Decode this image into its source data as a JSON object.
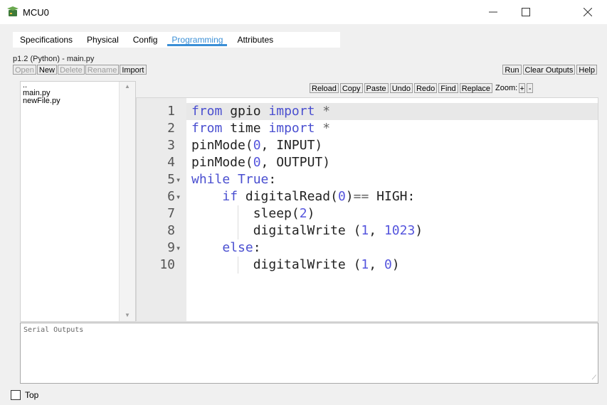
{
  "window": {
    "title": "MCU0",
    "icon": "mcu-device-icon",
    "controls": {
      "minimize": "—",
      "maximize": "☐",
      "close": "✕"
    }
  },
  "tabs": [
    {
      "label": "Specifications",
      "active": false
    },
    {
      "label": "Physical",
      "active": false
    },
    {
      "label": "Config",
      "active": false
    },
    {
      "label": "Programming",
      "active": true
    },
    {
      "label": "Attributes",
      "active": false
    }
  ],
  "project": {
    "label": "p1.2 (Python) - main.py"
  },
  "file_buttons": {
    "open": "Open",
    "new": "New",
    "delete": "Delete",
    "rename": "Rename",
    "import": "Import"
  },
  "run_buttons": {
    "run": "Run",
    "clear": "Clear Outputs",
    "help": "Help"
  },
  "files": [
    "..",
    "main.py",
    "newFile.py"
  ],
  "editor_toolbar": {
    "reload": "Reload",
    "copy": "Copy",
    "paste": "Paste",
    "undo": "Undo",
    "redo": "Redo",
    "find": "Find",
    "replace": "Replace",
    "zoom_label": "Zoom:",
    "zoom_in": "+",
    "zoom_out": "-"
  },
  "code_lines": [
    {
      "n": "1",
      "fold": "",
      "text": "from gpio import *"
    },
    {
      "n": "2",
      "fold": "",
      "text": "from time import *"
    },
    {
      "n": "3",
      "fold": "",
      "text": "pinMode(0, INPUT)"
    },
    {
      "n": "4",
      "fold": "",
      "text": "pinMode(0, OUTPUT)"
    },
    {
      "n": "5",
      "fold": "▾",
      "text": "while True:"
    },
    {
      "n": "6",
      "fold": "▾",
      "text": "    if digitalRead(0)== HIGH:"
    },
    {
      "n": "7",
      "fold": "",
      "text": "        sleep(2)"
    },
    {
      "n": "8",
      "fold": "",
      "text": "        digitalWrite (1, 1023)"
    },
    {
      "n": "9",
      "fold": "▾",
      "text": "    else:"
    },
    {
      "n": "10",
      "fold": "",
      "text": "        digitalWrite (1, 0)"
    }
  ],
  "serial": {
    "placeholder": "Serial Outputs"
  },
  "bottom": {
    "top_label": "Top"
  },
  "colors": {
    "accent": "#3a8fd6",
    "keyword": "#4a4fd0"
  }
}
